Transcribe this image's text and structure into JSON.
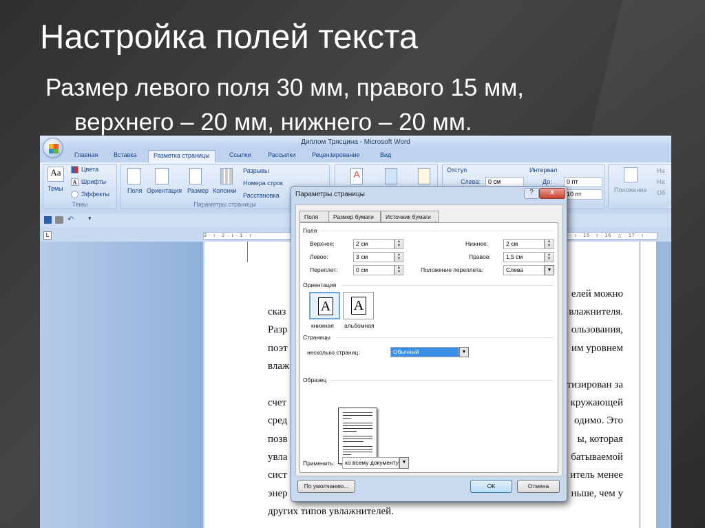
{
  "slide": {
    "title": "Настройка полей текста",
    "subtitle_line1": "Размер левого поля 30 мм, правого 15 мм,",
    "subtitle_line2": "верхнего – 20 мм, нижнего – 20 мм."
  },
  "word": {
    "window_title": "Диплом Трясцина - Microsoft Word",
    "tabs": [
      "Главная",
      "Вставка",
      "Разметка страницы",
      "Ссылки",
      "Рассылки",
      "Рецензирование",
      "Вид"
    ],
    "ribbon": {
      "themes": {
        "themes_btn": "Темы",
        "colors": "Цвета",
        "fonts": "Шрифты",
        "effects": "Эффекты",
        "group": "Темы"
      },
      "page_setup": {
        "margins": "Поля",
        "orientation": "Ориентация",
        "size": "Размер",
        "columns": "Колонки",
        "breaks": "Разрывы",
        "line_numbers": "Номера строк",
        "hyphenation": "Расстановка",
        "group": "Параметры страницы"
      },
      "indent": {
        "label": "Отступ",
        "left_label": "Слева:",
        "left_value": "0 см"
      },
      "spacing": {
        "label": "Интервал",
        "before_label": "До:",
        "before_value": "0 пт",
        "after_value": "10 пт"
      },
      "arrange": {
        "position": "Положение",
        "f1": "На",
        "f2": "На",
        "f3": "Об"
      }
    },
    "ruler": {
      "left": "3 · ı · 2 · ı · 1 · ı · ",
      "right": "14 · ı · 15 · ı · 16 · △ · 17 · ı ·"
    },
    "document_lines": [
      {
        "left": "",
        "right": "елей можно"
      },
      {
        "left": "сказ",
        "right": "влажнителя."
      },
      {
        "left": "Разр",
        "right": "ользования,"
      },
      {
        "left": "поэт",
        "right": "им уровнем"
      },
      {
        "left": "влаж",
        "right": ""
      },
      {
        "left": "",
        "right": "тизирован за"
      },
      {
        "left": "счет",
        "right": "кружающей"
      },
      {
        "left": "сред",
        "right": "одимо. Это"
      },
      {
        "left": "позв",
        "right": "ы, которая"
      },
      {
        "left": "увла",
        "right": "батываемой"
      },
      {
        "left": "сист",
        "right": "итель менее"
      },
      {
        "left": "энер",
        "right": "ньше, чем у"
      },
      {
        "left": "других типов увлажнителей.",
        "right": ""
      }
    ]
  },
  "dialog": {
    "title": "Параметры страницы",
    "help": "?",
    "close": "x",
    "tabs": [
      "Поля",
      "Размер бумаги",
      "Источник бумаги"
    ],
    "margins_section": "Поля",
    "top_label": "Верхнее:",
    "top_value": "2 см",
    "left_label": "Левое:",
    "left_value": "3 см",
    "gutter_label": "Переплет:",
    "gutter_value": "0 см",
    "bottom_label": "Нижнее:",
    "bottom_value": "2 см",
    "right_label": "Правое:",
    "right_value": "1,5 см",
    "gutter_pos_label": "Положение переплета:",
    "gutter_pos_value": "Слева",
    "orientation_section": "Ориентация",
    "portrait": "книжная",
    "landscape": "альбомная",
    "orient_glyph": "A",
    "pages_section": "Страницы",
    "multiple_pages_label": "несколько страниц:",
    "multiple_pages_value": "Обычный",
    "preview_section": "Образец",
    "apply_label": "Применить:",
    "apply_value": "ко всему документу",
    "default_btn": "По умолчанию...",
    "ok_btn": "ОК",
    "cancel_btn": "Отмена"
  }
}
